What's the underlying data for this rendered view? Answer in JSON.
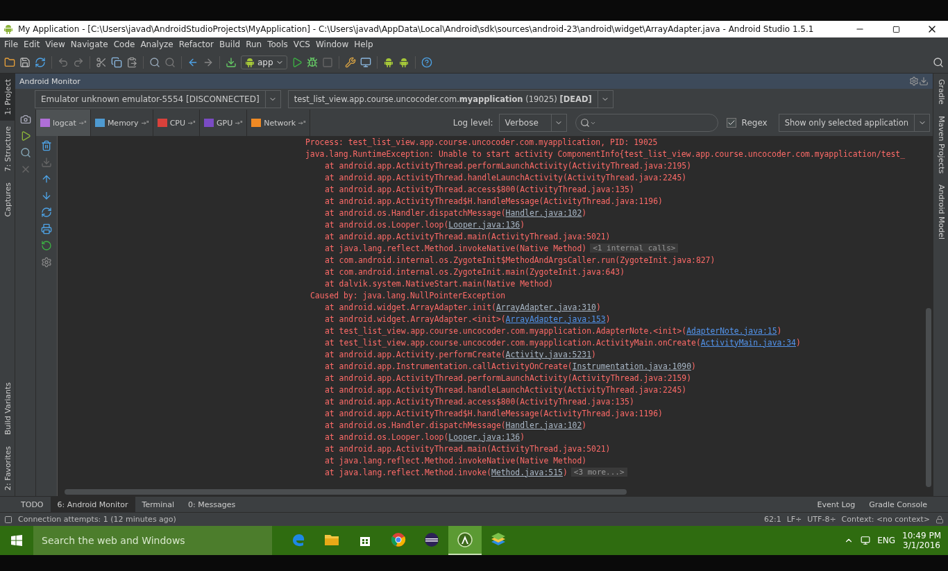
{
  "window": {
    "title": "My Application - [C:\\Users\\javad\\AndroidStudioProjects\\MyApplication] - C:\\Users\\javad\\AppData\\Local\\Android\\sdk\\sources\\android-23\\android\\widget\\ArrayAdapter.java - Android Studio 1.5.1"
  },
  "menu": [
    "File",
    "Edit",
    "View",
    "Navigate",
    "Code",
    "Analyze",
    "Refactor",
    "Build",
    "Run",
    "Tools",
    "VCS",
    "Window",
    "Help"
  ],
  "toolbar": {
    "run_config": "app"
  },
  "left_stripe": {
    "top": [
      {
        "label": "1: Project",
        "selected": true
      },
      {
        "label": "7: Structure",
        "selected": false
      },
      {
        "label": "Captures",
        "selected": false
      }
    ],
    "bottom": [
      {
        "label": "Build Variants",
        "selected": false
      },
      {
        "label": "2: Favorites",
        "selected": false
      }
    ]
  },
  "right_stripe": [
    {
      "label": "Gradle"
    },
    {
      "label": "Maven Projects"
    },
    {
      "label": "Android Model"
    }
  ],
  "monitor": {
    "title": "Android Monitor",
    "device": "Emulator unknown emulator-5554 [DISCONNECTED]",
    "process": "test_list_view.app.course.uncocoder.com.**myapplication** (19025) **[DEAD]**",
    "tabs": [
      {
        "label": "logcat",
        "selected": true,
        "color": "#b06fd8"
      },
      {
        "label": "Memory",
        "selected": false,
        "color": "#4e9ad1"
      },
      {
        "label": "CPU",
        "selected": false,
        "color": "#d8413b"
      },
      {
        "label": "GPU",
        "selected": false,
        "color": "#7a4bc4"
      },
      {
        "label": "Network",
        "selected": false,
        "color": "#f08a24"
      }
    ],
    "log_level_label": "Log level:",
    "log_level": "Verbose",
    "regex": {
      "label": "Regex",
      "checked": true
    },
    "filter": "Show only selected application",
    "log": [
      {
        "kind": "header",
        "text": "Process: test_list_view.app.course.uncocoder.com.myapplication, PID: 19025"
      },
      {
        "kind": "header",
        "text": "java.lang.RuntimeException: Unable to start activity ComponentInfo{test_list_view.app.course.uncocoder.com.myapplication/test_"
      },
      {
        "kind": "frame",
        "text": "at android.app.ActivityThread.performLaunchActivity(ActivityThread.java:2195)"
      },
      {
        "kind": "frame",
        "text": "at android.app.ActivityThread.handleLaunchActivity(ActivityThread.java:2245)"
      },
      {
        "kind": "frame",
        "text": "at android.app.ActivityThread.access$800(ActivityThread.java:135)"
      },
      {
        "kind": "frame",
        "text": "at android.app.ActivityThread$H.handleMessage(ActivityThread.java:1196)"
      },
      {
        "kind": "frame",
        "text": "at android.os.Handler.dispatchMessage(",
        "link": {
          "text": "Handler.java:102",
          "kind": "library"
        },
        "tail": ")"
      },
      {
        "kind": "frame",
        "text": "at android.os.Looper.loop(",
        "link": {
          "text": "Looper.java:136",
          "kind": "library"
        },
        "tail": ")"
      },
      {
        "kind": "frame",
        "text": "at android.app.ActivityThread.main(ActivityThread.java:5021)"
      },
      {
        "kind": "frame",
        "text": "at java.lang.reflect.Method.invokeNative(Native Method)",
        "fold": "<1 internal calls>"
      },
      {
        "kind": "frame",
        "text": "at com.android.internal.os.ZygoteInit$MethodAndArgsCaller.run(ZygoteInit.java:827)"
      },
      {
        "kind": "frame",
        "text": "at com.android.internal.os.ZygoteInit.main(ZygoteInit.java:643)"
      },
      {
        "kind": "frame",
        "text": "at dalvik.system.NativeStart.main(Native Method)"
      },
      {
        "kind": "cause",
        "text": "Caused by: java.lang.NullPointerException"
      },
      {
        "kind": "frame",
        "text": "at android.widget.ArrayAdapter.init(",
        "link": {
          "text": "ArrayAdapter.java:310",
          "kind": "library"
        },
        "tail": ")"
      },
      {
        "kind": "frame",
        "text": "at android.widget.ArrayAdapter.<init>(",
        "link": {
          "text": "ArrayAdapter.java:153",
          "kind": "project"
        },
        "tail": ")"
      },
      {
        "kind": "frame",
        "text": "at test_list_view.app.course.uncocoder.com.myapplication.AdapterNote.<init>(",
        "link": {
          "text": "AdapterNote.java:15",
          "kind": "project"
        },
        "tail": ")"
      },
      {
        "kind": "frame",
        "text": "at test_list_view.app.course.uncocoder.com.myapplication.ActivityMain.onCreate(",
        "link": {
          "text": "ActivityMain.java:34",
          "kind": "project"
        },
        "tail": ")"
      },
      {
        "kind": "frame",
        "text": "at android.app.Activity.performCreate(",
        "link": {
          "text": "Activity.java:5231",
          "kind": "library"
        },
        "tail": ")"
      },
      {
        "kind": "frame",
        "text": "at android.app.Instrumentation.callActivityOnCreate(",
        "link": {
          "text": "Instrumentation.java:1090",
          "kind": "library"
        },
        "tail": ")"
      },
      {
        "kind": "frame",
        "text": "at android.app.ActivityThread.performLaunchActivity(ActivityThread.java:2159)"
      },
      {
        "kind": "frame",
        "text": "at android.app.ActivityThread.handleLaunchActivity(ActivityThread.java:2245)"
      },
      {
        "kind": "frame",
        "text": "at android.app.ActivityThread.access$800(ActivityThread.java:135)"
      },
      {
        "kind": "frame",
        "text": "at android.app.ActivityThread$H.handleMessage(ActivityThread.java:1196)"
      },
      {
        "kind": "frame",
        "text": "at android.os.Handler.dispatchMessage(",
        "link": {
          "text": "Handler.java:102",
          "kind": "library"
        },
        "tail": ")"
      },
      {
        "kind": "frame",
        "text": "at android.os.Looper.loop(",
        "link": {
          "text": "Looper.java:136",
          "kind": "library"
        },
        "tail": ")"
      },
      {
        "kind": "frame",
        "text": "at android.app.ActivityThread.main(ActivityThread.java:5021)"
      },
      {
        "kind": "frame",
        "text": "at java.lang.reflect.Method.invokeNative(Native Method)"
      },
      {
        "kind": "frame",
        "text": "at java.lang.reflect.Method.invoke(",
        "link": {
          "text": "Method.java:515",
          "kind": "library"
        },
        "tail": ")",
        "fold": "<3 more...>"
      }
    ]
  },
  "tool_tabs": {
    "left": [
      {
        "label": "TODO",
        "selected": false
      },
      {
        "label": "6: Android Monitor",
        "selected": true
      },
      {
        "label": "Terminal",
        "selected": false
      },
      {
        "label": "0: Messages",
        "selected": false
      }
    ],
    "right": [
      {
        "label": "Event Log"
      },
      {
        "label": "Gradle Console"
      }
    ]
  },
  "status_bar": {
    "message": "Connection attempts: 1 (12 minutes ago)",
    "position": "62:1",
    "line_sep": "LF÷",
    "encoding": "UTF-8÷",
    "context": "Context: <no context>"
  },
  "taskbar": {
    "search_placeholder": "Search the web and Windows",
    "apps": [
      {
        "kind": "edge",
        "selected": false
      },
      {
        "kind": "explorer",
        "selected": false
      },
      {
        "kind": "store",
        "selected": false
      },
      {
        "kind": "chrome",
        "selected": false
      },
      {
        "kind": "eclipse",
        "selected": false
      },
      {
        "kind": "studio",
        "selected": true
      },
      {
        "kind": "stack",
        "selected": false
      }
    ],
    "language": "ENG",
    "time": "10:49 PM",
    "date": "3/1/2016"
  }
}
